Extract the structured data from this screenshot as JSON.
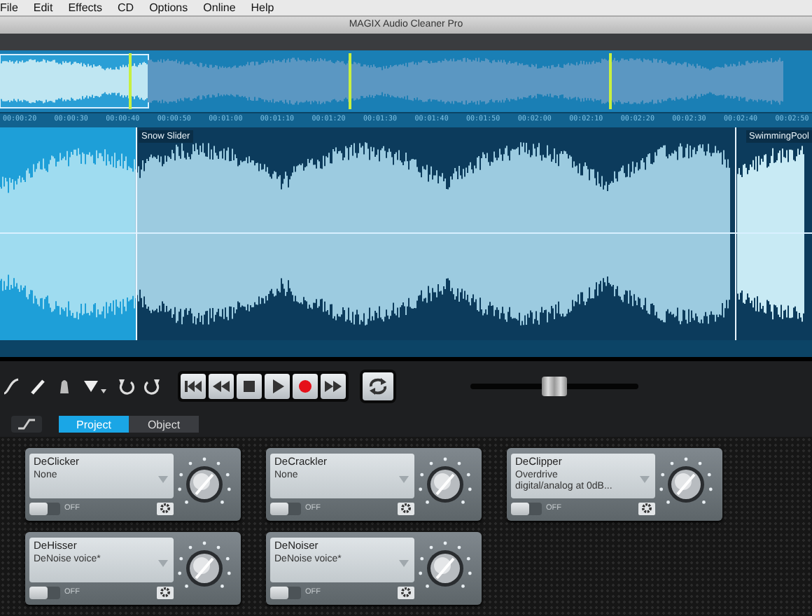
{
  "menu": [
    "File",
    "Edit",
    "Effects",
    "CD",
    "Options",
    "Online",
    "Help"
  ],
  "window": {
    "title": "MAGIX Audio Cleaner Pro"
  },
  "ruler": [
    "00:00:20",
    "00:00:30",
    "00:00:40",
    "00:00:50",
    "00:01:00",
    "00:01:10",
    "00:01:20",
    "00:01:30",
    "00:01:40",
    "00:01:50",
    "00:02:00",
    "00:02:10",
    "00:02:20",
    "00:02:30",
    "00:02:40",
    "00:02:50"
  ],
  "markers": [
    {
      "label": "Snow Slider",
      "selected": false
    },
    {
      "label": "SwimmingPool",
      "selected": false
    }
  ],
  "transport": [
    {
      "kind": "start"
    },
    {
      "kind": "rewind"
    },
    {
      "kind": "stop"
    },
    {
      "kind": "play"
    },
    {
      "kind": "record"
    },
    {
      "kind": "forward"
    }
  ],
  "shuttle": {
    "level": 0.5
  },
  "tabs": [
    {
      "label": "Project",
      "selected": true
    },
    {
      "label": "Object",
      "selected": false
    }
  ],
  "effects": [
    {
      "name": "DeClicker",
      "preset": "None",
      "on": false,
      "switch_label": "OFF"
    },
    {
      "name": "DeCrackler",
      "preset": "None",
      "on": false,
      "switch_label": "OFF"
    },
    {
      "name": "DeClipper",
      "preset": "Overdrive\ndigital/analog at 0dB...",
      "on": false,
      "switch_label": "OFF"
    },
    {
      "name": "DeHisser",
      "preset": "DeNoise voice*",
      "on": false,
      "switch_label": "OFF"
    },
    {
      "name": "DeNoiser",
      "preset": "DeNoise voice*",
      "on": false,
      "switch_label": "OFF"
    }
  ]
}
